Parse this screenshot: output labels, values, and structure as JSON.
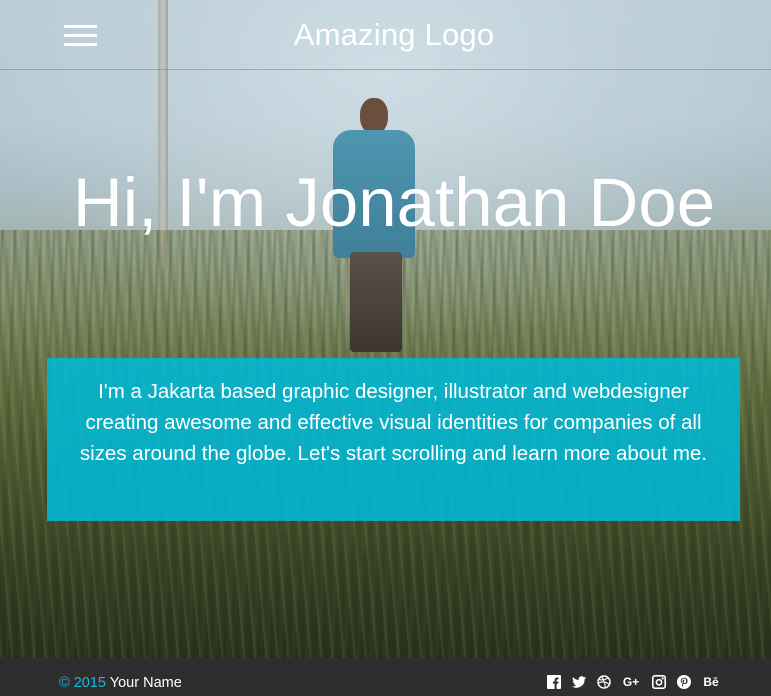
{
  "header": {
    "logo": "Amazing Logo",
    "menu_icon": "hamburger-menu-icon"
  },
  "hero": {
    "headline": "Hi, I'm Jonathan Doe",
    "intro": "I'm a Jakarta based graphic designer, illustrator and webdesigner creating awesome and effective visual identities for companies of all sizes around the globe. Let's start scrolling and learn more about me.",
    "intro_bg": "#00b8d6"
  },
  "footer": {
    "copyright_symbol": "©",
    "year": "2015",
    "name": "Your Name",
    "accent_color": "#19b9d9",
    "social_icons": [
      {
        "name": "facebook-icon"
      },
      {
        "name": "twitter-icon"
      },
      {
        "name": "dribbble-icon"
      },
      {
        "name": "google-plus-icon",
        "label": "G+"
      },
      {
        "name": "instagram-icon"
      },
      {
        "name": "pinterest-icon"
      },
      {
        "name": "behance-icon",
        "label": "Bē"
      }
    ]
  }
}
